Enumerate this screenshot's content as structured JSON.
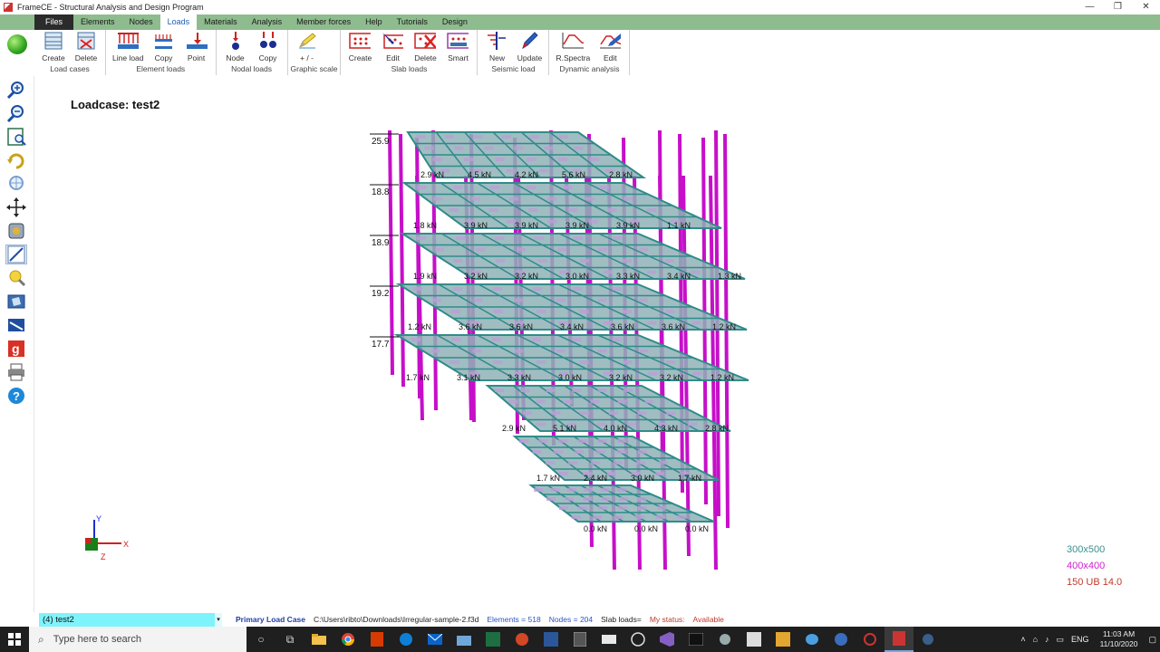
{
  "window": {
    "title": "FrameCE - Structural Analysis and Design Program",
    "min": "—",
    "max": "❐",
    "close": "✕"
  },
  "menu": {
    "items": [
      "Files",
      "Elements",
      "Nodes",
      "Loads",
      "Materials",
      "Analysis",
      "Member forces",
      "Help",
      "Tutorials",
      "Design"
    ],
    "active": "Loads"
  },
  "ribbon": {
    "groups": [
      {
        "label": "Load cases",
        "buttons": [
          {
            "label": "Create",
            "icon": "create-table-icon"
          },
          {
            "label": "Delete",
            "icon": "delete-table-icon"
          }
        ]
      },
      {
        "label": "Element loads",
        "buttons": [
          {
            "label": "Line load",
            "icon": "line-load-icon"
          },
          {
            "label": "Copy",
            "icon": "copy-line-load-icon"
          },
          {
            "label": "Point",
            "icon": "point-load-icon"
          }
        ]
      },
      {
        "label": "Nodal loads",
        "buttons": [
          {
            "label": "Node",
            "icon": "node-load-icon"
          },
          {
            "label": "Copy",
            "icon": "copy-node-load-icon"
          }
        ]
      },
      {
        "label": "Graphic scale",
        "buttons": [
          {
            "label": "+ / -",
            "icon": "pencil-scale-icon"
          }
        ]
      },
      {
        "label": "Slab loads",
        "buttons": [
          {
            "label": "Create",
            "icon": "slab-create-icon"
          },
          {
            "label": "Edit",
            "icon": "slab-edit-icon"
          },
          {
            "label": "Delete",
            "icon": "slab-delete-icon"
          },
          {
            "label": "Smart",
            "icon": "slab-smart-icon"
          }
        ]
      },
      {
        "label": "Seismic load",
        "buttons": [
          {
            "label": "New",
            "icon": "seismic-new-icon"
          },
          {
            "label": "Update",
            "icon": "seismic-update-icon"
          }
        ]
      },
      {
        "label": "Dynamic analysis",
        "buttons": [
          {
            "label": "R.Spectra",
            "icon": "response-spectra-icon"
          },
          {
            "label": "Edit",
            "icon": "spectra-edit-icon"
          }
        ]
      }
    ]
  },
  "left_tools": [
    "zoom-in-icon",
    "zoom-out-icon",
    "zoom-extents-icon",
    "rotate-icon",
    "zoom-window-icon",
    "pan-icon",
    "settings-icon",
    "draw-icon",
    "light-icon",
    "3d-view-icon",
    "screen-icon",
    "google-icon",
    "print-icon",
    "help-icon"
  ],
  "canvas": {
    "loadcase_label": "Loadcase: test2",
    "axis": {
      "x": "X",
      "y": "Y",
      "z": "Z"
    },
    "legend": [
      "300x500",
      "400x400",
      "150 UB 14.0"
    ],
    "colors": {
      "slab": "#3f8f8a",
      "slab_fill": "#8fb1b6",
      "slab_patch": "#b99fd6",
      "column": "#c60fc9",
      "beam": "#2e8b8b",
      "text": "#111111"
    },
    "level_labels": [
      "25.9",
      "18.8",
      "18.9",
      "19.2",
      "17.7"
    ],
    "kn_rows": [
      [
        "2.9 kN",
        "4.5 kN",
        "4.2 kN",
        "5.6 kN",
        "2.8 kN"
      ],
      [
        "1.8 kN",
        "3.9 kN",
        "3.9 kN",
        "3.9 kN",
        "3.9 kN",
        "1.1 kN"
      ],
      [
        "1.9 kN",
        "3.2 kN",
        "3.2 kN",
        "3.0 kN",
        "3.3 kN",
        "3.4 kN",
        "1.3 kN"
      ],
      [
        "1.2 kN",
        "3.6 kN",
        "3.6 kN",
        "3.4 kN",
        "3.6 kN",
        "3.6 kN",
        "1.2 kN"
      ],
      [
        "1.7 kN",
        "3.1 kN",
        "3.3 kN",
        "3.0 kN",
        "3.2 kN",
        "3.2 kN",
        "1.2 kN"
      ],
      [
        "2.9 kN",
        "5.1 kN",
        "4.0 kN",
        "4.3 kN",
        "2.8 kN"
      ],
      [
        "1.7 kN",
        "2.4 kN",
        "3.0 kN",
        "1.7 kN"
      ],
      [
        "0.0 kN",
        "0.0 kN",
        "0.0 kN"
      ]
    ]
  },
  "status": {
    "loadcase": "(4) test2",
    "primary": "Primary Load Case",
    "path": "C:\\Users\\ribto\\Downloads\\Irregular-sample-2.f3d",
    "elements": "Elements = 518",
    "nodes": "Nodes = 204",
    "slab": "Slab loads=",
    "mystatus": "My status:",
    "available": "Available"
  },
  "taskbar": {
    "search_placeholder": "Type here to search",
    "lang": "ENG",
    "time": "11:03 AM",
    "date": "11/10/2020"
  }
}
